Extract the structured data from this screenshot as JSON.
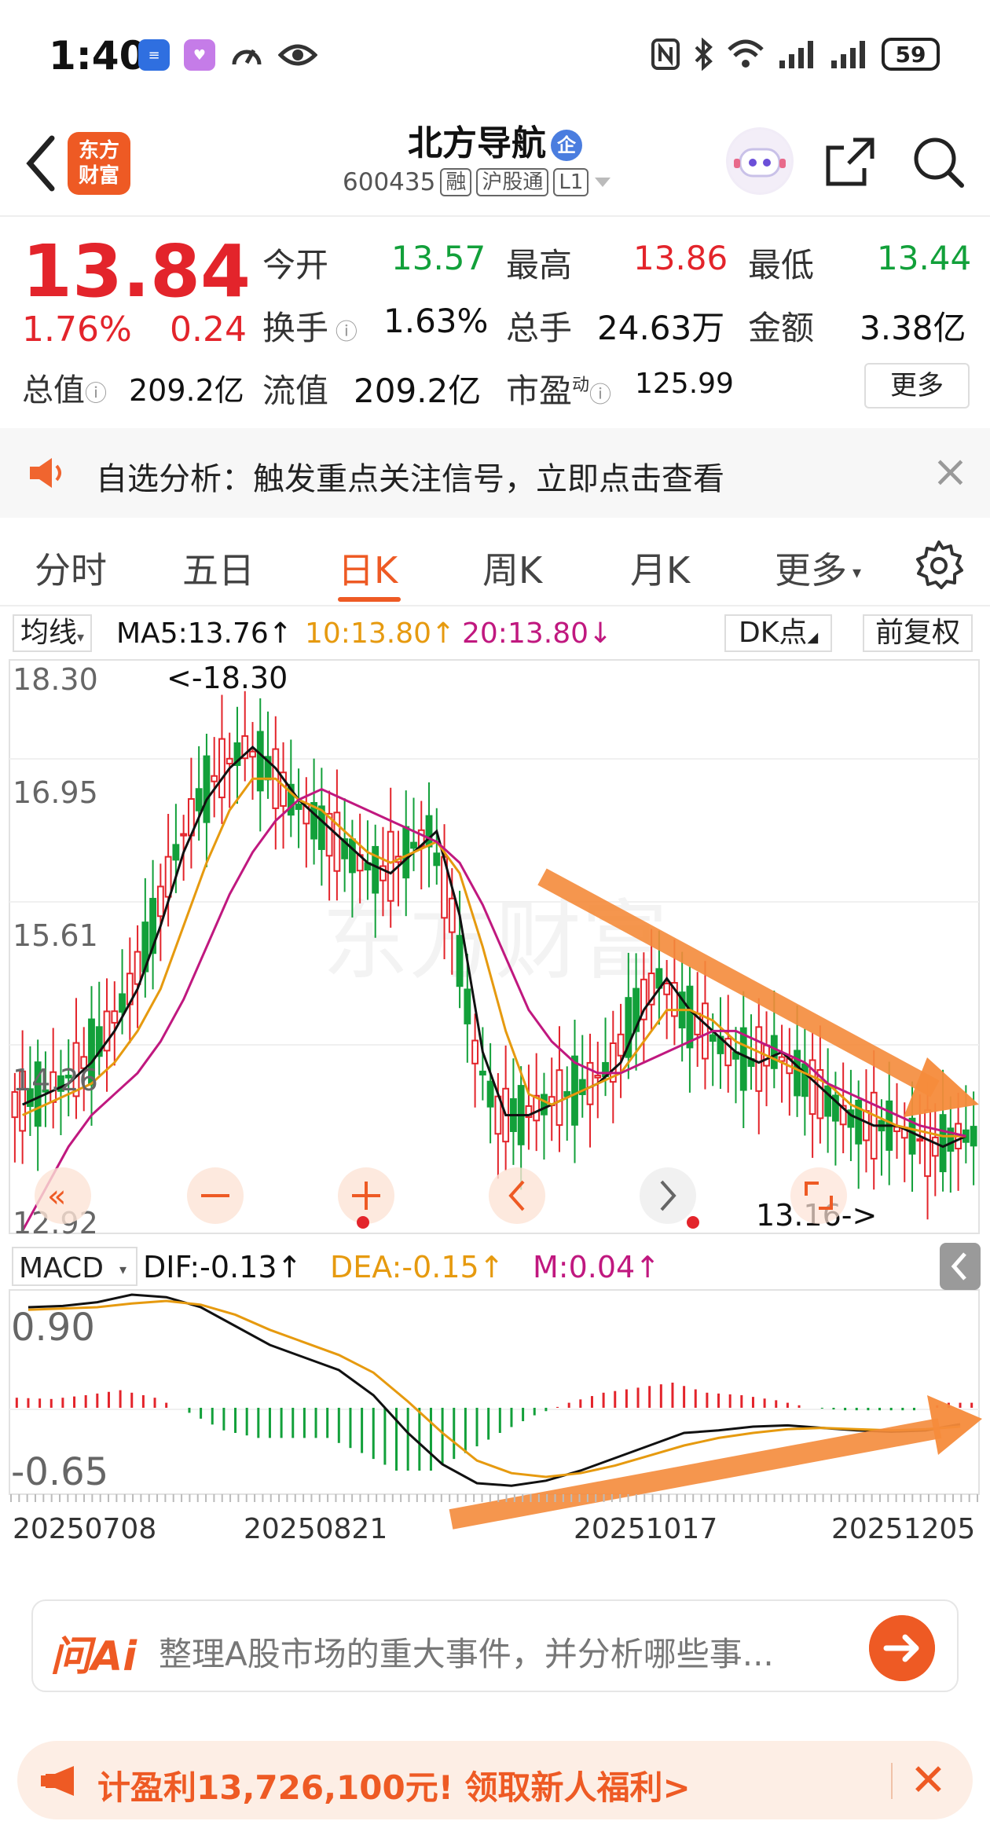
{
  "status_bar": {
    "time": "1:40",
    "battery": "59",
    "app_icons": [
      "app-icon-blue",
      "app-icon-pink",
      "speedometer-icon",
      "eye-icon"
    ]
  },
  "nav": {
    "logo_text_1": "东方",
    "logo_text_2": "财富",
    "stock_name": "北方导航",
    "enterprise_badge": "企",
    "stock_code": "600435",
    "tag_margin": "融",
    "tag_connect": "沪股通",
    "tag_level": "L1"
  },
  "quote": {
    "price": "13.84",
    "change_pct": "1.76%",
    "change": "0.24",
    "open_label": "今开",
    "open": "13.57",
    "high_label": "最高",
    "high": "13.86",
    "low_label": "最低",
    "low": "13.44",
    "turnover_label": "换手",
    "turnover": "1.63%",
    "volume_label": "总手",
    "volume": "24.63万",
    "amount_label": "金额",
    "amount": "3.38亿",
    "mktcap_label": "总值",
    "mktcap": "209.2亿",
    "float_label": "流值",
    "float_cap": "209.2亿",
    "pe_label": "市盈",
    "pe_sup": "动",
    "pe": "125.99",
    "more": "更多"
  },
  "notice": {
    "text": "自选分析：触发重点关注信号，立即点击查看"
  },
  "tabs": {
    "items": [
      "分时",
      "五日",
      "日K",
      "周K",
      "月K",
      "更多"
    ],
    "active_index": 2
  },
  "ma_legend": {
    "selector": "均线",
    "ma5": "MA5:13.76↑",
    "ma10": "10:13.80↑",
    "ma20": "20:13.80↓",
    "dk": "DK点",
    "adjust": "前复权"
  },
  "colors": {
    "up": "#e3242b",
    "down": "#12a03a",
    "ma5": "#111111",
    "ma10": "#e69a0f",
    "ma20": "#c0187f",
    "accent": "#ee5a24",
    "arrow": "#f58b3b"
  },
  "chart_data": [
    {
      "type": "candlestick",
      "y_axis_labels": [
        "18.30",
        "16.95",
        "15.61",
        "14.26",
        "12.92"
      ],
      "ylim": [
        12.92,
        18.3
      ],
      "annotations": {
        "max": "<-18.30",
        "min": "13.16->"
      },
      "max_value": 18.3,
      "min_value": 13.16,
      "x_tick_labels": [
        "20250708",
        "20250821",
        "20251017",
        "20251205"
      ],
      "trend_arrow": "down",
      "series": [
        {
          "name": "MA5",
          "values": [
            14.1,
            14.2,
            14.3,
            14.5,
            14.8,
            15.2,
            15.8,
            16.5,
            17.0,
            17.3,
            17.5,
            17.3,
            17.0,
            16.8,
            16.6,
            16.4,
            16.3,
            16.5,
            16.7,
            15.9,
            14.6,
            14.0,
            14.0,
            14.1,
            14.2,
            14.3,
            14.5,
            15.0,
            15.3,
            15.0,
            14.8,
            14.6,
            14.5,
            14.6,
            14.4,
            14.2,
            14.0,
            13.9,
            13.9,
            13.8,
            13.7,
            13.8
          ]
        },
        {
          "name": "10",
          "values": [
            14.0,
            14.1,
            14.2,
            14.3,
            14.5,
            14.8,
            15.2,
            15.8,
            16.4,
            16.9,
            17.2,
            17.2,
            17.0,
            16.9,
            16.7,
            16.5,
            16.4,
            16.5,
            16.6,
            16.3,
            15.6,
            14.8,
            14.2,
            14.1,
            14.2,
            14.3,
            14.4,
            14.7,
            15.0,
            15.0,
            14.9,
            14.7,
            14.6,
            14.5,
            14.4,
            14.3,
            14.1,
            14.0,
            13.9,
            13.85,
            13.8,
            13.8
          ]
        },
        {
          "name": "20",
          "values": [
            12.9,
            13.3,
            13.7,
            14.0,
            14.2,
            14.4,
            14.7,
            15.1,
            15.6,
            16.1,
            16.5,
            16.8,
            17.0,
            17.1,
            17.0,
            16.9,
            16.8,
            16.7,
            16.6,
            16.4,
            16.0,
            15.5,
            15.0,
            14.7,
            14.5,
            14.4,
            14.4,
            14.5,
            14.6,
            14.7,
            14.8,
            14.8,
            14.7,
            14.6,
            14.5,
            14.3,
            14.2,
            14.1,
            14.0,
            13.9,
            13.85,
            13.8
          ]
        }
      ]
    },
    {
      "type": "bar",
      "name": "MACD",
      "selector": "MACD",
      "dif_label": "DIF:-0.13↑",
      "dea_label": "DEA:-0.15↑",
      "m_label": "M:0.04↑",
      "y_axis_labels": [
        "0.90",
        "-0.65"
      ],
      "ylim": [
        -0.65,
        0.9
      ],
      "trend_arrow": "up",
      "series": [
        {
          "name": "DIF",
          "values": [
            0.8,
            0.81,
            0.84,
            0.9,
            0.88,
            0.8,
            0.65,
            0.5,
            0.4,
            0.3,
            0.1,
            -0.2,
            -0.45,
            -0.6,
            -0.62,
            -0.58,
            -0.5,
            -0.4,
            -0.3,
            -0.2,
            -0.18,
            -0.15,
            -0.14,
            -0.16,
            -0.18,
            -0.19,
            -0.18,
            -0.13
          ]
        },
        {
          "name": "DEA",
          "values": [
            0.78,
            0.79,
            0.8,
            0.83,
            0.85,
            0.82,
            0.74,
            0.62,
            0.52,
            0.42,
            0.28,
            0.05,
            -0.2,
            -0.42,
            -0.52,
            -0.55,
            -0.52,
            -0.46,
            -0.38,
            -0.3,
            -0.24,
            -0.2,
            -0.17,
            -0.16,
            -0.17,
            -0.18,
            -0.17,
            -0.15
          ]
        },
        {
          "name": "M",
          "values": [
            0.08,
            0.07,
            0.1,
            0.14,
            0.08,
            -0.04,
            -0.18,
            -0.24,
            -0.24,
            -0.24,
            -0.36,
            -0.5,
            -0.5,
            -0.36,
            -0.2,
            -0.06,
            0.04,
            0.12,
            0.16,
            0.2,
            0.12,
            0.1,
            0.06,
            0.0,
            -0.02,
            -0.02,
            -0.02,
            0.04
          ]
        }
      ]
    }
  ],
  "ai_bar": {
    "logo": "问Ai",
    "prompt": "整理A股市场的重大事件，并分析哪些事..."
  },
  "promo": {
    "text": "计盈利13,726,100元! 领取新人福利>"
  }
}
